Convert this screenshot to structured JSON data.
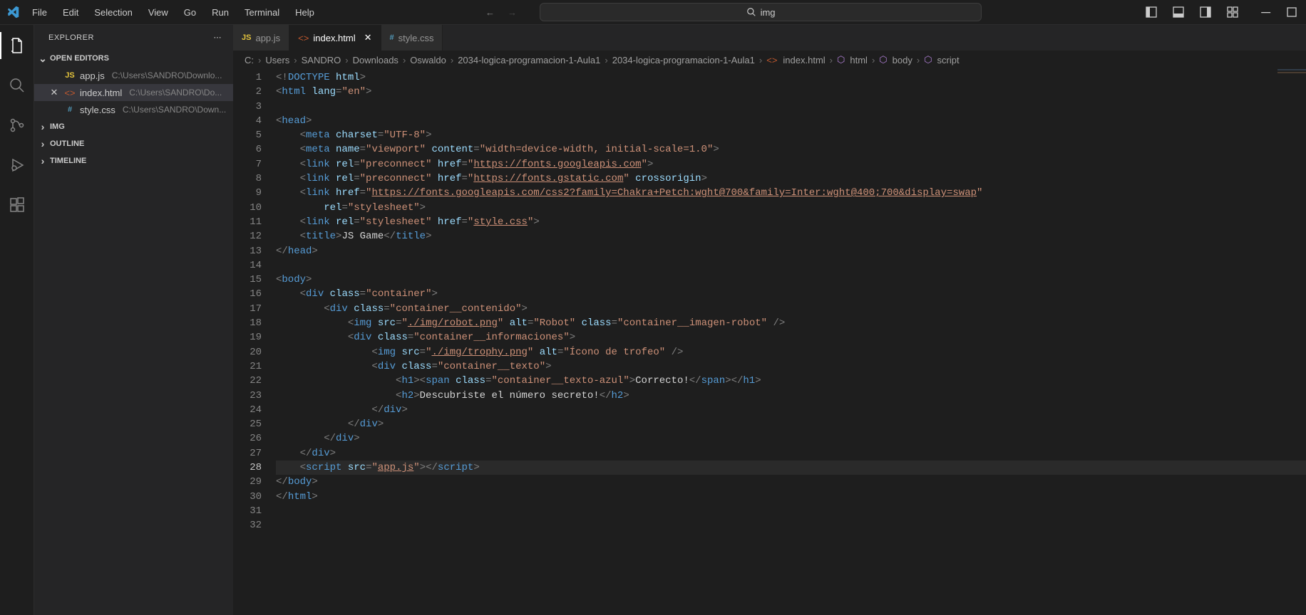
{
  "menubar": [
    "File",
    "Edit",
    "Selection",
    "View",
    "Go",
    "Run",
    "Terminal",
    "Help"
  ],
  "search": {
    "value": "img"
  },
  "sidebar": {
    "title": "EXPLORER",
    "openEditors": "OPEN EDITORS",
    "files": [
      {
        "name": "app.js",
        "path": "C:\\Users\\SANDRO\\Downlo..."
      },
      {
        "name": "index.html",
        "path": "C:\\Users\\SANDRO\\Do..."
      },
      {
        "name": "style.css",
        "path": "C:\\Users\\SANDRO\\Down..."
      }
    ],
    "sections": [
      "IMG",
      "OUTLINE",
      "TIMELINE"
    ]
  },
  "tabs": [
    {
      "label": "app.js"
    },
    {
      "label": "index.html"
    },
    {
      "label": "style.css"
    }
  ],
  "breadcrumbs": [
    "C:",
    "Users",
    "SANDRO",
    "Downloads",
    "Oswaldo",
    "2034-logica-programacion-1-Aula1",
    "2034-logica-programacion-1-Aula1",
    "index.html",
    "html",
    "body",
    "script"
  ],
  "code": {
    "lines": [
      [
        {
          "t": "<!",
          "c": "tag-bracket"
        },
        {
          "t": "DOCTYPE",
          "c": "doctype"
        },
        {
          "t": " ",
          "c": "text-content"
        },
        {
          "t": "html",
          "c": "attr-name"
        },
        {
          "t": ">",
          "c": "tag-bracket"
        }
      ],
      [
        {
          "t": "<",
          "c": "tag-bracket"
        },
        {
          "t": "html",
          "c": "tag-name"
        },
        {
          "t": " ",
          "c": ""
        },
        {
          "t": "lang",
          "c": "attr-name"
        },
        {
          "t": "=",
          "c": "tag-bracket"
        },
        {
          "t": "\"en\"",
          "c": "attr-value"
        },
        {
          "t": ">",
          "c": "tag-bracket"
        }
      ],
      [],
      [
        {
          "t": "<",
          "c": "tag-bracket"
        },
        {
          "t": "head",
          "c": "tag-name"
        },
        {
          "t": ">",
          "c": "tag-bracket"
        }
      ],
      [
        {
          "t": "    ",
          "c": ""
        },
        {
          "t": "<",
          "c": "tag-bracket"
        },
        {
          "t": "meta",
          "c": "tag-name"
        },
        {
          "t": " ",
          "c": ""
        },
        {
          "t": "charset",
          "c": "attr-name"
        },
        {
          "t": "=",
          "c": "tag-bracket"
        },
        {
          "t": "\"UTF-8\"",
          "c": "attr-value"
        },
        {
          "t": ">",
          "c": "tag-bracket"
        }
      ],
      [
        {
          "t": "    ",
          "c": ""
        },
        {
          "t": "<",
          "c": "tag-bracket"
        },
        {
          "t": "meta",
          "c": "tag-name"
        },
        {
          "t": " ",
          "c": ""
        },
        {
          "t": "name",
          "c": "attr-name"
        },
        {
          "t": "=",
          "c": "tag-bracket"
        },
        {
          "t": "\"viewport\"",
          "c": "attr-value"
        },
        {
          "t": " ",
          "c": ""
        },
        {
          "t": "content",
          "c": "attr-name"
        },
        {
          "t": "=",
          "c": "tag-bracket"
        },
        {
          "t": "\"width=device-width, initial-scale=1.0\"",
          "c": "attr-value"
        },
        {
          "t": ">",
          "c": "tag-bracket"
        }
      ],
      [
        {
          "t": "    ",
          "c": ""
        },
        {
          "t": "<",
          "c": "tag-bracket"
        },
        {
          "t": "link",
          "c": "tag-name"
        },
        {
          "t": " ",
          "c": ""
        },
        {
          "t": "rel",
          "c": "attr-name"
        },
        {
          "t": "=",
          "c": "tag-bracket"
        },
        {
          "t": "\"preconnect\"",
          "c": "attr-value"
        },
        {
          "t": " ",
          "c": ""
        },
        {
          "t": "href",
          "c": "attr-name"
        },
        {
          "t": "=",
          "c": "tag-bracket"
        },
        {
          "t": "\"",
          "c": "attr-value"
        },
        {
          "t": "https://fonts.googleapis.com",
          "c": "attr-value underline"
        },
        {
          "t": "\"",
          "c": "attr-value"
        },
        {
          "t": ">",
          "c": "tag-bracket"
        }
      ],
      [
        {
          "t": "    ",
          "c": ""
        },
        {
          "t": "<",
          "c": "tag-bracket"
        },
        {
          "t": "link",
          "c": "tag-name"
        },
        {
          "t": " ",
          "c": ""
        },
        {
          "t": "rel",
          "c": "attr-name"
        },
        {
          "t": "=",
          "c": "tag-bracket"
        },
        {
          "t": "\"preconnect\"",
          "c": "attr-value"
        },
        {
          "t": " ",
          "c": ""
        },
        {
          "t": "href",
          "c": "attr-name"
        },
        {
          "t": "=",
          "c": "tag-bracket"
        },
        {
          "t": "\"",
          "c": "attr-value"
        },
        {
          "t": "https://fonts.gstatic.com",
          "c": "attr-value underline"
        },
        {
          "t": "\"",
          "c": "attr-value"
        },
        {
          "t": " ",
          "c": ""
        },
        {
          "t": "crossorigin",
          "c": "attr-name"
        },
        {
          "t": ">",
          "c": "tag-bracket"
        }
      ],
      [
        {
          "t": "    ",
          "c": ""
        },
        {
          "t": "<",
          "c": "tag-bracket"
        },
        {
          "t": "link",
          "c": "tag-name"
        },
        {
          "t": " ",
          "c": ""
        },
        {
          "t": "href",
          "c": "attr-name"
        },
        {
          "t": "=",
          "c": "tag-bracket"
        },
        {
          "t": "\"",
          "c": "attr-value"
        },
        {
          "t": "https://fonts.googleapis.com/css2?family=Chakra+Petch:wght@700&family=Inter:wght@400;700&display=swap",
          "c": "attr-value underline"
        },
        {
          "t": "\"",
          "c": "attr-value"
        }
      ],
      [
        {
          "t": "        ",
          "c": ""
        },
        {
          "t": "rel",
          "c": "attr-name"
        },
        {
          "t": "=",
          "c": "tag-bracket"
        },
        {
          "t": "\"stylesheet\"",
          "c": "attr-value"
        },
        {
          "t": ">",
          "c": "tag-bracket"
        }
      ],
      [
        {
          "t": "    ",
          "c": ""
        },
        {
          "t": "<",
          "c": "tag-bracket"
        },
        {
          "t": "link",
          "c": "tag-name"
        },
        {
          "t": " ",
          "c": ""
        },
        {
          "t": "rel",
          "c": "attr-name"
        },
        {
          "t": "=",
          "c": "tag-bracket"
        },
        {
          "t": "\"stylesheet\"",
          "c": "attr-value"
        },
        {
          "t": " ",
          "c": ""
        },
        {
          "t": "href",
          "c": "attr-name"
        },
        {
          "t": "=",
          "c": "tag-bracket"
        },
        {
          "t": "\"",
          "c": "attr-value"
        },
        {
          "t": "style.css",
          "c": "attr-value underline"
        },
        {
          "t": "\"",
          "c": "attr-value"
        },
        {
          "t": ">",
          "c": "tag-bracket"
        }
      ],
      [
        {
          "t": "    ",
          "c": ""
        },
        {
          "t": "<",
          "c": "tag-bracket"
        },
        {
          "t": "title",
          "c": "tag-name"
        },
        {
          "t": ">",
          "c": "tag-bracket"
        },
        {
          "t": "JS Game",
          "c": "text-content"
        },
        {
          "t": "</",
          "c": "tag-bracket"
        },
        {
          "t": "title",
          "c": "tag-name"
        },
        {
          "t": ">",
          "c": "tag-bracket"
        }
      ],
      [
        {
          "t": "</",
          "c": "tag-bracket"
        },
        {
          "t": "head",
          "c": "tag-name"
        },
        {
          "t": ">",
          "c": "tag-bracket"
        }
      ],
      [],
      [
        {
          "t": "<",
          "c": "tag-bracket"
        },
        {
          "t": "body",
          "c": "tag-name"
        },
        {
          "t": ">",
          "c": "tag-bracket"
        }
      ],
      [
        {
          "t": "    ",
          "c": ""
        },
        {
          "t": "<",
          "c": "tag-bracket"
        },
        {
          "t": "div",
          "c": "tag-name"
        },
        {
          "t": " ",
          "c": ""
        },
        {
          "t": "class",
          "c": "attr-name"
        },
        {
          "t": "=",
          "c": "tag-bracket"
        },
        {
          "t": "\"container\"",
          "c": "attr-value"
        },
        {
          "t": ">",
          "c": "tag-bracket"
        }
      ],
      [
        {
          "t": "        ",
          "c": ""
        },
        {
          "t": "<",
          "c": "tag-bracket"
        },
        {
          "t": "div",
          "c": "tag-name"
        },
        {
          "t": " ",
          "c": ""
        },
        {
          "t": "class",
          "c": "attr-name"
        },
        {
          "t": "=",
          "c": "tag-bracket"
        },
        {
          "t": "\"container__contenido\"",
          "c": "attr-value"
        },
        {
          "t": ">",
          "c": "tag-bracket"
        }
      ],
      [
        {
          "t": "            ",
          "c": ""
        },
        {
          "t": "<",
          "c": "tag-bracket"
        },
        {
          "t": "img",
          "c": "tag-name"
        },
        {
          "t": " ",
          "c": ""
        },
        {
          "t": "src",
          "c": "attr-name"
        },
        {
          "t": "=",
          "c": "tag-bracket"
        },
        {
          "t": "\"",
          "c": "attr-value"
        },
        {
          "t": "./img/robot.png",
          "c": "attr-value underline"
        },
        {
          "t": "\"",
          "c": "attr-value"
        },
        {
          "t": " ",
          "c": ""
        },
        {
          "t": "alt",
          "c": "attr-name"
        },
        {
          "t": "=",
          "c": "tag-bracket"
        },
        {
          "t": "\"Robot\"",
          "c": "attr-value"
        },
        {
          "t": " ",
          "c": ""
        },
        {
          "t": "class",
          "c": "attr-name"
        },
        {
          "t": "=",
          "c": "tag-bracket"
        },
        {
          "t": "\"container__imagen-robot\"",
          "c": "attr-value"
        },
        {
          "t": " />",
          "c": "tag-bracket"
        }
      ],
      [
        {
          "t": "            ",
          "c": ""
        },
        {
          "t": "<",
          "c": "tag-bracket"
        },
        {
          "t": "div",
          "c": "tag-name"
        },
        {
          "t": " ",
          "c": ""
        },
        {
          "t": "class",
          "c": "attr-name"
        },
        {
          "t": "=",
          "c": "tag-bracket"
        },
        {
          "t": "\"container__informaciones\"",
          "c": "attr-value"
        },
        {
          "t": ">",
          "c": "tag-bracket"
        }
      ],
      [
        {
          "t": "                ",
          "c": ""
        },
        {
          "t": "<",
          "c": "tag-bracket"
        },
        {
          "t": "img",
          "c": "tag-name"
        },
        {
          "t": " ",
          "c": ""
        },
        {
          "t": "src",
          "c": "attr-name"
        },
        {
          "t": "=",
          "c": "tag-bracket"
        },
        {
          "t": "\"",
          "c": "attr-value"
        },
        {
          "t": "./img/trophy.png",
          "c": "attr-value underline"
        },
        {
          "t": "\"",
          "c": "attr-value"
        },
        {
          "t": " ",
          "c": ""
        },
        {
          "t": "alt",
          "c": "attr-name"
        },
        {
          "t": "=",
          "c": "tag-bracket"
        },
        {
          "t": "\"Ícono de trofeo\"",
          "c": "attr-value"
        },
        {
          "t": " />",
          "c": "tag-bracket"
        }
      ],
      [
        {
          "t": "                ",
          "c": ""
        },
        {
          "t": "<",
          "c": "tag-bracket"
        },
        {
          "t": "div",
          "c": "tag-name"
        },
        {
          "t": " ",
          "c": ""
        },
        {
          "t": "class",
          "c": "attr-name"
        },
        {
          "t": "=",
          "c": "tag-bracket"
        },
        {
          "t": "\"container__texto\"",
          "c": "attr-value"
        },
        {
          "t": ">",
          "c": "tag-bracket"
        }
      ],
      [
        {
          "t": "                    ",
          "c": ""
        },
        {
          "t": "<",
          "c": "tag-bracket"
        },
        {
          "t": "h1",
          "c": "tag-name"
        },
        {
          "t": "><",
          "c": "tag-bracket"
        },
        {
          "t": "span",
          "c": "tag-name"
        },
        {
          "t": " ",
          "c": ""
        },
        {
          "t": "class",
          "c": "attr-name"
        },
        {
          "t": "=",
          "c": "tag-bracket"
        },
        {
          "t": "\"container__texto-azul\"",
          "c": "attr-value"
        },
        {
          "t": ">",
          "c": "tag-bracket"
        },
        {
          "t": "Correcto!",
          "c": "text-content"
        },
        {
          "t": "</",
          "c": "tag-bracket"
        },
        {
          "t": "span",
          "c": "tag-name"
        },
        {
          "t": "></",
          "c": "tag-bracket"
        },
        {
          "t": "h1",
          "c": "tag-name"
        },
        {
          "t": ">",
          "c": "tag-bracket"
        }
      ],
      [
        {
          "t": "                    ",
          "c": ""
        },
        {
          "t": "<",
          "c": "tag-bracket"
        },
        {
          "t": "h2",
          "c": "tag-name"
        },
        {
          "t": ">",
          "c": "tag-bracket"
        },
        {
          "t": "Descubriste el número secreto!",
          "c": "text-content"
        },
        {
          "t": "</",
          "c": "tag-bracket"
        },
        {
          "t": "h2",
          "c": "tag-name"
        },
        {
          "t": ">",
          "c": "tag-bracket"
        }
      ],
      [
        {
          "t": "                ",
          "c": ""
        },
        {
          "t": "</",
          "c": "tag-bracket"
        },
        {
          "t": "div",
          "c": "tag-name"
        },
        {
          "t": ">",
          "c": "tag-bracket"
        }
      ],
      [
        {
          "t": "            ",
          "c": ""
        },
        {
          "t": "</",
          "c": "tag-bracket"
        },
        {
          "t": "div",
          "c": "tag-name"
        },
        {
          "t": ">",
          "c": "tag-bracket"
        }
      ],
      [
        {
          "t": "        ",
          "c": ""
        },
        {
          "t": "</",
          "c": "tag-bracket"
        },
        {
          "t": "div",
          "c": "tag-name"
        },
        {
          "t": ">",
          "c": "tag-bracket"
        }
      ],
      [
        {
          "t": "    ",
          "c": ""
        },
        {
          "t": "</",
          "c": "tag-bracket"
        },
        {
          "t": "div",
          "c": "tag-name"
        },
        {
          "t": ">",
          "c": "tag-bracket"
        }
      ],
      [
        {
          "t": "    ",
          "c": ""
        },
        {
          "t": "<",
          "c": "tag-bracket"
        },
        {
          "t": "script",
          "c": "tag-name"
        },
        {
          "t": " ",
          "c": ""
        },
        {
          "t": "src",
          "c": "attr-name"
        },
        {
          "t": "=",
          "c": "tag-bracket"
        },
        {
          "t": "\"",
          "c": "attr-value"
        },
        {
          "t": "app.js",
          "c": "attr-value underline"
        },
        {
          "t": "\"",
          "c": "attr-value"
        },
        {
          "t": "></",
          "c": "tag-bracket"
        },
        {
          "t": "script",
          "c": "tag-name"
        },
        {
          "t": ">",
          "c": "tag-bracket"
        }
      ],
      [
        {
          "t": "</",
          "c": "tag-bracket"
        },
        {
          "t": "body",
          "c": "tag-name"
        },
        {
          "t": ">",
          "c": "tag-bracket"
        }
      ],
      [
        {
          "t": "</",
          "c": "tag-bracket"
        },
        {
          "t": "html",
          "c": "tag-name"
        },
        {
          "t": ">",
          "c": "tag-bracket"
        }
      ],
      [],
      []
    ],
    "currentLine": 28
  }
}
